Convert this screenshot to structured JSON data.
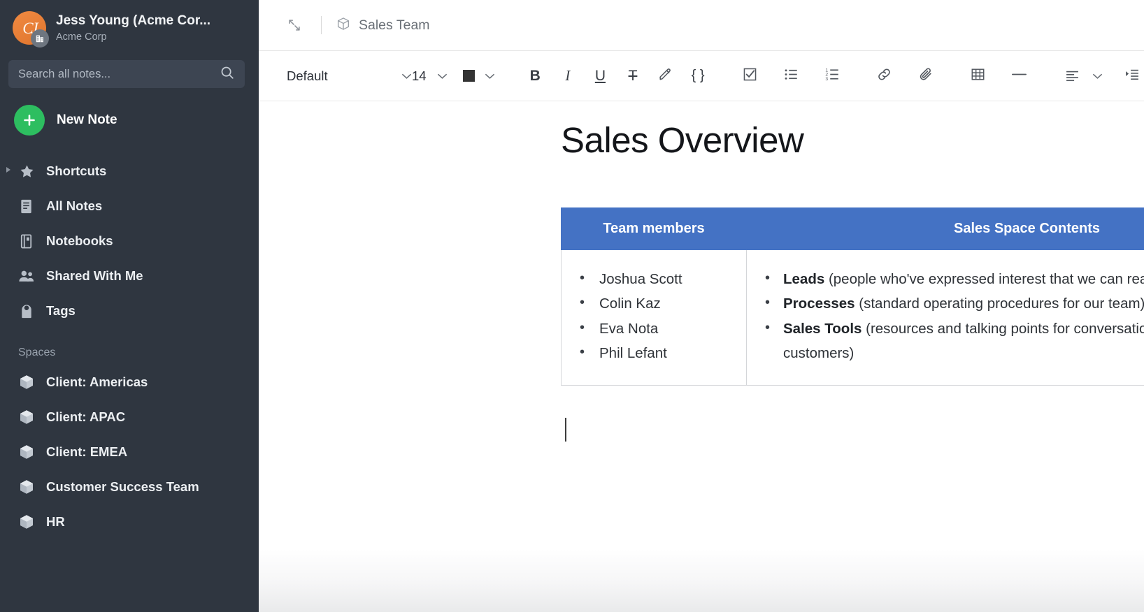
{
  "sidebar": {
    "account": {
      "name": "Jess Young (Acme Cor...",
      "org": "Acme Corp",
      "avatar_initials": "CJ",
      "avatar_color": "#e8803a",
      "badge_icon": "building-icon"
    },
    "search": {
      "placeholder": "Search all notes...",
      "value": "",
      "icon": "search-icon"
    },
    "new_note": {
      "label": "New Note",
      "icon": "plus-icon",
      "color": "#2dbe60"
    },
    "nav_items": [
      {
        "label": "Shortcuts",
        "icon": "star-icon",
        "has_disclosure": true
      },
      {
        "label": "All Notes",
        "icon": "notes-icon",
        "has_disclosure": false
      },
      {
        "label": "Notebooks",
        "icon": "notebook-icon",
        "has_disclosure": false
      },
      {
        "label": "Shared With Me",
        "icon": "people-icon",
        "has_disclosure": false
      },
      {
        "label": "Tags",
        "icon": "tag-icon",
        "has_disclosure": false
      }
    ],
    "spaces_header": "Spaces",
    "spaces": [
      {
        "label": "Client: Americas",
        "icon": "cube-icon"
      },
      {
        "label": "Client: APAC",
        "icon": "cube-icon"
      },
      {
        "label": "Client: EMEA",
        "icon": "cube-icon"
      },
      {
        "label": "Customer Success Team",
        "icon": "cube-icon"
      },
      {
        "label": "HR",
        "icon": "cube-icon"
      }
    ],
    "background_color": "#2f3640"
  },
  "topbar": {
    "collapse_icon": "collapse-arrows-icon",
    "space_icon": "cube-outline-icon",
    "space_name": "Sales Team"
  },
  "toolbar": {
    "font_family": "Default",
    "font_size": "14",
    "font_color": "#333333",
    "buttons": [
      {
        "name": "bold-button",
        "glyph": "B",
        "title": "Bold"
      },
      {
        "name": "italic-button",
        "glyph": "I",
        "title": "Italic"
      },
      {
        "name": "underline-button",
        "glyph": "U",
        "title": "Underline"
      },
      {
        "name": "strikethrough-button",
        "glyph": "T",
        "title": "Strikethrough"
      },
      {
        "name": "highlight-button",
        "glyph": "",
        "title": "Highlight"
      },
      {
        "name": "code-button",
        "glyph": "{ }",
        "title": "Code"
      },
      {
        "name": "checklist-button",
        "glyph": "",
        "title": "Checklist"
      },
      {
        "name": "bulleted-list-button",
        "glyph": "",
        "title": "Bulleted list"
      },
      {
        "name": "numbered-list-button",
        "glyph": "",
        "title": "Numbered list"
      },
      {
        "name": "link-button",
        "glyph": "",
        "title": "Link"
      },
      {
        "name": "attachment-button",
        "glyph": "",
        "title": "Attach file"
      },
      {
        "name": "table-button",
        "glyph": "",
        "title": "Insert table"
      },
      {
        "name": "horizontal-rule-button",
        "glyph": "",
        "title": "Horizontal rule"
      },
      {
        "name": "align-button",
        "glyph": "",
        "title": "Alignment"
      },
      {
        "name": "indent-button",
        "glyph": "",
        "title": "Indent"
      }
    ]
  },
  "document": {
    "title": "Sales Overview",
    "table": {
      "headers": [
        "Team members",
        "Sales Space Contents"
      ],
      "header_bg": "#4472c4",
      "team_members": [
        "Joshua Scott",
        "Colin Kaz",
        "Eva Nota",
        "Phil Lefant"
      ],
      "space_contents": [
        {
          "term": "Leads",
          "desc": " (people who've expressed interest that we can reach out to)"
        },
        {
          "term": "Processes",
          "desc": " (standard operating procedures for our team)"
        },
        {
          "term": "Sales Tools",
          "desc": " (resources and talking points for conversations with leads and customers)"
        }
      ]
    }
  }
}
